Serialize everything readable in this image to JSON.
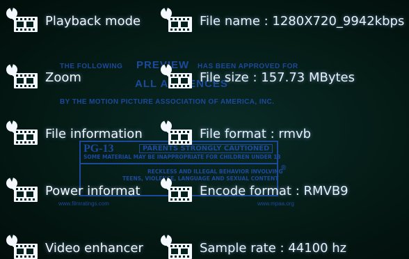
{
  "menu": {
    "left_items": [
      {
        "label": "Playback mode",
        "icon": "settings-film-icon"
      },
      {
        "label": "Zoom",
        "icon": "settings-film-icon"
      },
      {
        "label": "File information",
        "icon": "settings-film-icon"
      },
      {
        "label": "Power informat",
        "icon": "settings-film-icon"
      },
      {
        "label": "Video enhancer",
        "icon": "settings-film-icon"
      }
    ],
    "right_items": [
      {
        "label": "File name : 1280X720_9942kbps",
        "icon": "settings-film-icon"
      },
      {
        "label": "File size : 157.73 MBytes",
        "icon": "settings-film-icon"
      },
      {
        "label": "File format : rmvb",
        "icon": "settings-film-icon"
      },
      {
        "label": "Encode format : RMVB9",
        "icon": "settings-film-icon"
      },
      {
        "label": "Sample rate : 44100 hz",
        "icon": "settings-film-icon"
      }
    ]
  },
  "background_card": {
    "line1": "THE FOLLOWING",
    "preview": "PREVIEW",
    "approved": "HAS BEEN APPROVED FOR",
    "audiences": "ALL AUDIENCES",
    "line3": "BY THE MOTION PICTURE ASSOCIATION OF AMERICA, INC.",
    "rating": "PG-13",
    "caution": "PARENTS STRONGLY CAUTIONED",
    "some_material": "SOME MATERIAL MAY BE INAPPROPRIATE FOR CHILDREN UNDER 13",
    "reckless": "RECKLESS AND ILLEGAL BEHAVIOR INVOLVING",
    "teen": "TEENS, VIOLENCE, LANGUAGE AND SEXUAL CONTENT",
    "url1": "www.filmratings.com",
    "url2": "www.mpaa.org",
    "registered": "®"
  },
  "colors": {
    "background": "#02150f",
    "text": "#eaf3ff",
    "icon": "#f4f8ff",
    "card": "#1f4ea8"
  }
}
